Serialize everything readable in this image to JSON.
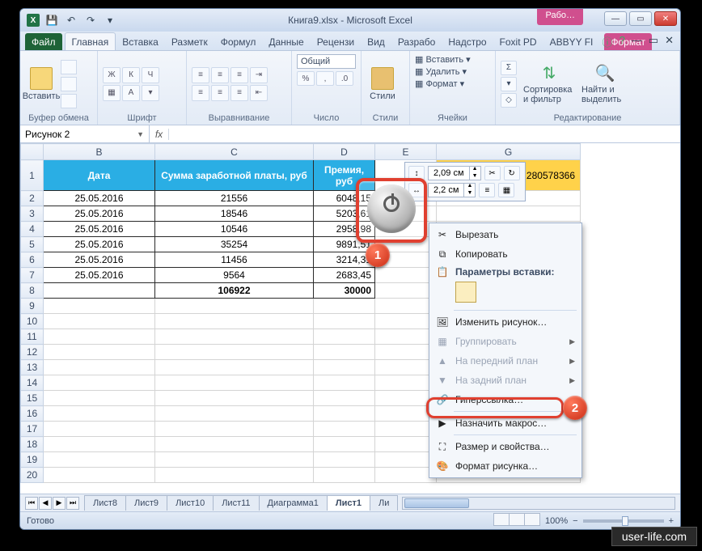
{
  "window": {
    "title": "Книга9.xlsx - Microsoft Excel",
    "extraTab": "Рабо…"
  },
  "tabs": {
    "file": "Файл",
    "items": [
      "Главная",
      "Вставка",
      "Разметк",
      "Формул",
      "Данные",
      "Рецензи",
      "Вид",
      "Разрабо",
      "Надстро",
      "Foxit PD",
      "ABBYY FI"
    ],
    "format": "Формат",
    "activeIndex": 0
  },
  "ribbon": {
    "paste": "Вставить",
    "groups": [
      "Буфер обмена",
      "Шрифт",
      "Выравнивание",
      "Число",
      "Стили",
      "Ячейки",
      "Редактирование"
    ],
    "numberFormat": "Общий",
    "cells": {
      "insert": "Вставить",
      "delete": "Удалить",
      "format": "Формат"
    },
    "edit": {
      "sort": "Сортировка и фильтр",
      "find": "Найти и выделить"
    },
    "styles": "Стили"
  },
  "namebox": "Рисунок 2",
  "formula": "",
  "columns": [
    "B",
    "C",
    "D",
    "E",
    "G"
  ],
  "headers": {
    "b": "Дата",
    "c": "Сумма заработной платы, руб",
    "d": "Премия, руб"
  },
  "rows": [
    {
      "b": "25.05.2016",
      "c": "21556",
      "d": "6048,15"
    },
    {
      "b": "25.05.2016",
      "c": "18546",
      "d": "5203,61"
    },
    {
      "b": "25.05.2016",
      "c": "10546",
      "d": "2958,98"
    },
    {
      "b": "25.05.2016",
      "c": "35254",
      "d": "9891,51"
    },
    {
      "b": "25.05.2016",
      "c": "11456",
      "d": "3214,31"
    },
    {
      "b": "25.05.2016",
      "c": "9564",
      "d": "2683,45"
    }
  ],
  "totals": {
    "c": "106922",
    "d": "30000"
  },
  "gValue": "0,280578366",
  "sizePopup": {
    "h": "2,09 см",
    "w": "2,2 см"
  },
  "context": {
    "cut": "Вырезать",
    "copy": "Копировать",
    "pasteOptsLabel": "Параметры вставки:",
    "changePic": "Изменить рисунок…",
    "group": "Группировать",
    "bringFront": "На передний план",
    "sendBack": "На задний план",
    "hyperlink": "Гиперссылка…",
    "assignMacro": "Назначить макрос…",
    "sizeProps": "Размер и свойства…",
    "formatPic": "Формат рисунка…"
  },
  "sheetTabs": [
    "Лист8",
    "Лист9",
    "Лист10",
    "Лист11",
    "Диаграмма1",
    "Лист1",
    "Ли"
  ],
  "activeSheetIndex": 5,
  "status": "Готово",
  "zoom": "100%",
  "watermark": "user-life.com",
  "markers": {
    "one": "1",
    "two": "2"
  }
}
